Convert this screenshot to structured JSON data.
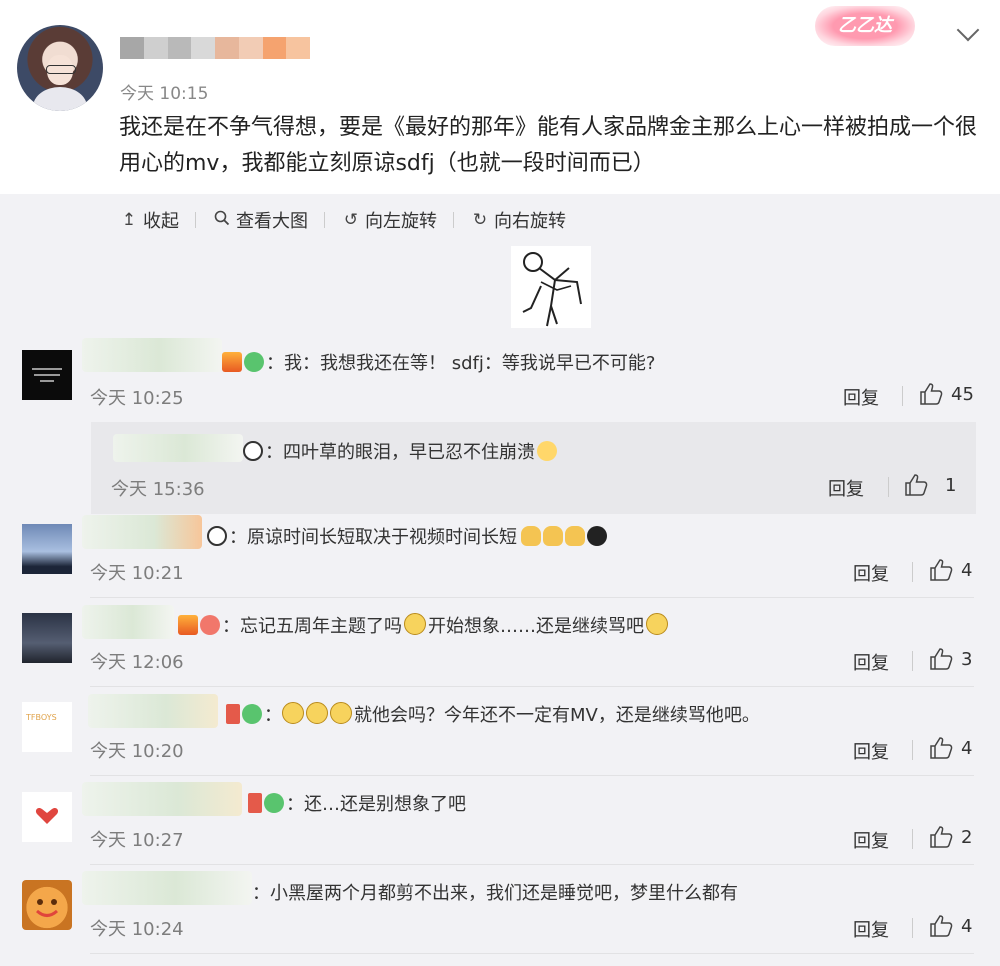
{
  "post": {
    "time": "今天 10:15",
    "text": "我还是在不争气得想，要是《最好的那年》能有人家品牌金主那么上心一样被拍成一个很用心的mv，我都能立刻原谅sdfj（也就一段时间而已）",
    "brand_deco": "乙乙达"
  },
  "toolbar": {
    "collapse": "收起",
    "view_large": "查看大图",
    "rotate_left": "向左旋转",
    "rotate_right": "向右旋转"
  },
  "actions": {
    "reply": "回复"
  },
  "comments": [
    {
      "text": "：我：我想我还在等！ sdfj：等我说早已不可能?",
      "time": "今天 10:25",
      "likes": "45"
    },
    {
      "text": "：原谅时间长短取决于视频时间长短",
      "time": "今天 10:21",
      "likes": "4"
    },
    {
      "text": "：忘记五周年主题了吗",
      "text2": "开始想象……还是继续骂吧",
      "time": "今天 12:06",
      "likes": "3"
    },
    {
      "text": "：",
      "text2": "就他会吗？今年还不一定有MV，还是继续骂他吧。",
      "time": "今天 10:20",
      "likes": "4"
    },
    {
      "text": "：还…还是别想象了吧",
      "time": "今天 10:27",
      "likes": "2"
    },
    {
      "text": "：小黑屋两个月都剪不出来，我们还是睡觉吧，梦里什么都有",
      "time": "今天 10:24",
      "likes": "4"
    }
  ],
  "sub_reply": {
    "text": "：四叶草的眼泪，早已忍不住崩溃",
    "time": "今天 15:36",
    "likes": "1"
  },
  "colors": {
    "gray_bg": "#f2f2f5",
    "sub_bg": "#e8e8eb",
    "text": "#333333",
    "time": "#7d7d7d"
  }
}
